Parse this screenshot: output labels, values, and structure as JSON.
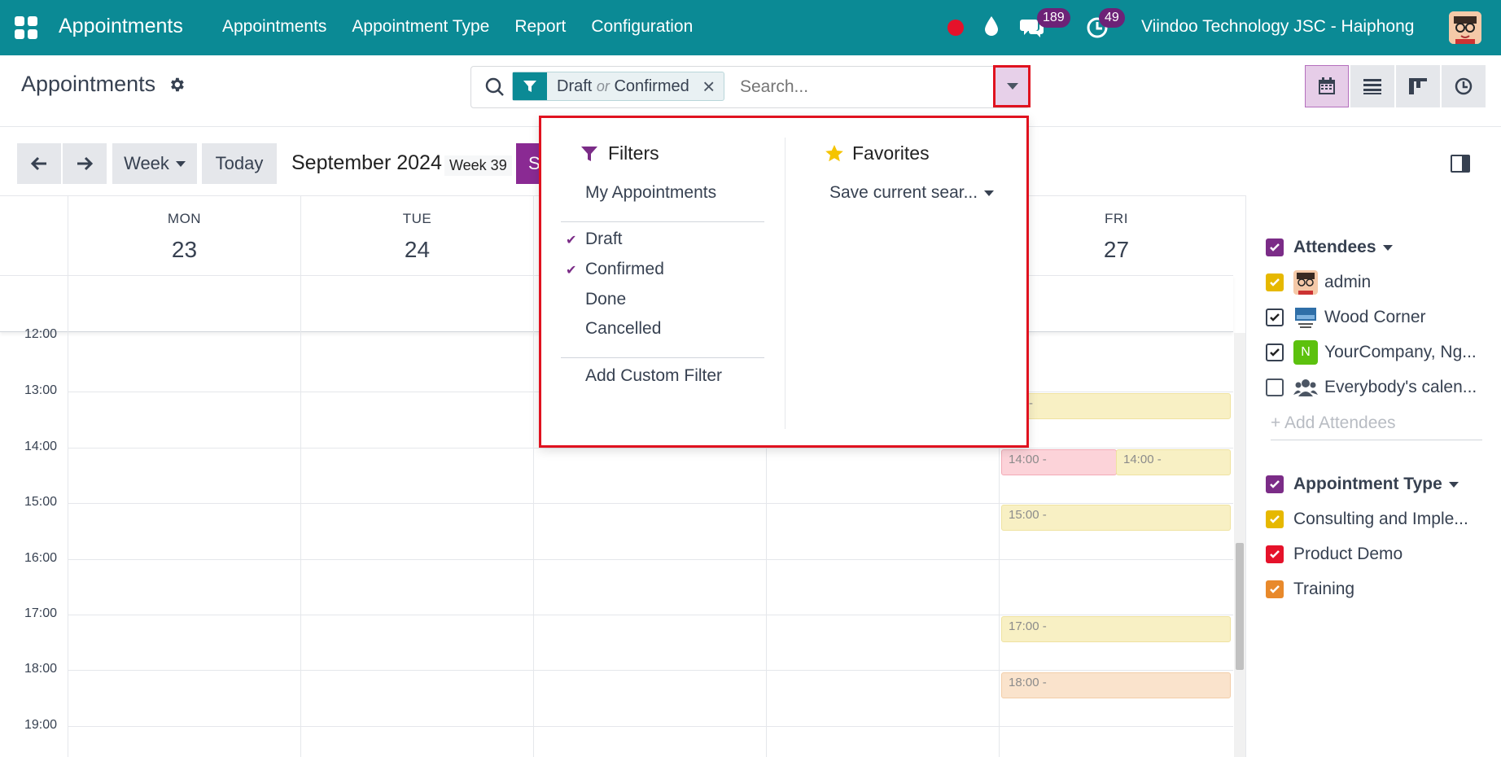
{
  "navbar": {
    "brand": "Appointments",
    "menu": [
      "Appointments",
      "Appointment Type",
      "Report",
      "Configuration"
    ],
    "chat_count": "189",
    "activity_count": "49",
    "company": "Viindoo Technology JSC - Haiphong"
  },
  "control_panel": {
    "title": "Appointments",
    "facet": {
      "value1": "Draft",
      "separator": "or",
      "value2": "Confirmed"
    },
    "search_placeholder": "Search..."
  },
  "toolbar": {
    "scale": "Week",
    "today": "Today",
    "period": "September 2024",
    "week": "Week 39",
    "purple_btn_text": "S"
  },
  "calendar": {
    "days": [
      {
        "name": "MON",
        "num": "23"
      },
      {
        "name": "TUE",
        "num": "24"
      },
      {
        "name": "",
        "num": ""
      },
      {
        "name": "",
        "num": ""
      },
      {
        "name": "FRI",
        "num": "27"
      }
    ],
    "hours": [
      "12:00",
      "13:00",
      "14:00",
      "15:00",
      "16:00",
      "17:00",
      "18:00",
      "19:00"
    ],
    "events": [
      {
        "label": ":00 -",
        "color": "yellow"
      },
      {
        "label": "14:00 -",
        "color": "pink"
      },
      {
        "label": "14:00 -",
        "color": "yellow"
      },
      {
        "label": "15:00 -",
        "color": "yellow"
      },
      {
        "label": "17:00 -",
        "color": "yellow"
      },
      {
        "label": "18:00 -",
        "color": "peach"
      }
    ]
  },
  "sidebar": {
    "attendees_title": "Attendees",
    "attendees": [
      {
        "label": "admin",
        "checkbox": "yellow"
      },
      {
        "label": "Wood Corner",
        "checkbox": "white"
      },
      {
        "label": "YourCompany, Ng...",
        "checkbox": "white",
        "avatar_letter": "N"
      },
      {
        "label": "Everybody's calen...",
        "checkbox": "empty"
      }
    ],
    "add_attendees": "+ Add Attendees",
    "types_title": "Appointment Type",
    "types": [
      {
        "label": "Consulting and Imple...",
        "color": "#e6b800"
      },
      {
        "label": "Product Demo",
        "color": "#e5122a"
      },
      {
        "label": "Training",
        "color": "#e8892b"
      }
    ]
  },
  "dropdown": {
    "filters_title": "Filters",
    "filters": [
      "My Appointments",
      "Draft",
      "Confirmed",
      "Done",
      "Cancelled",
      "Add Custom Filter"
    ],
    "checked": [
      "Draft",
      "Confirmed"
    ],
    "favorites_title": "Favorites",
    "save_search": "Save current sear..."
  },
  "colors": {
    "navbar": "#0b8a95",
    "primary_purple": "#8a2a93",
    "badge": "#6d2277",
    "highlight_red": "#e0121f"
  }
}
